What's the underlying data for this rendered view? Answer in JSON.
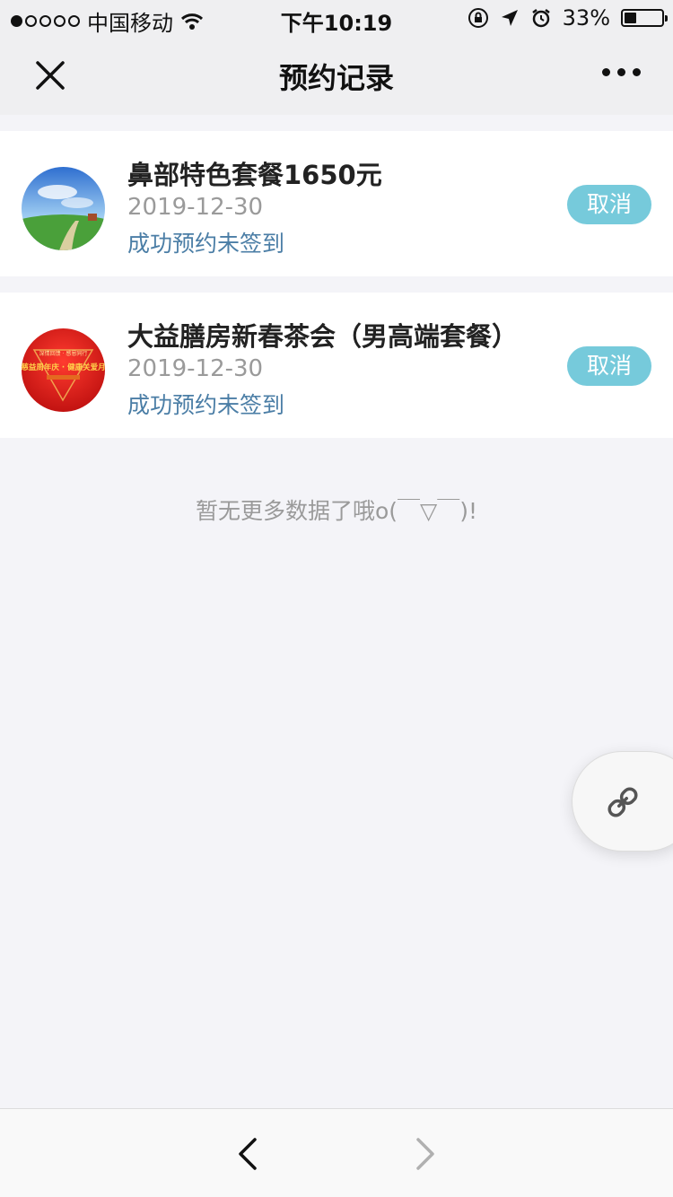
{
  "status_bar": {
    "carrier": "中国移动",
    "time": "下午10:19",
    "battery": "33%",
    "battery_level": 0.33
  },
  "nav": {
    "title": "预约记录"
  },
  "appointments": [
    {
      "title": "鼻部特色套餐1650元",
      "date": "2019-12-30",
      "status": "成功预约未签到",
      "cancel_label": "取消"
    },
    {
      "title": "大益膳房新春茶会（男高端套餐）",
      "date": "2019-12-30",
      "status": "成功预约未签到",
      "cancel_label": "取消",
      "thumb_text_top": "深情回馈 · 感恩同行",
      "thumb_text_main": "慈益周年庆 · 健康关爱月"
    }
  ],
  "empty_note": "暂无更多数据了哦o(￣▽￣)!",
  "colors": {
    "accent_button": "#76cadb",
    "status_text": "#4b7ea6",
    "background": "#f4f4f8"
  },
  "icons": [
    "wifi-icon",
    "lock-rotation-icon",
    "location-arrow-icon",
    "alarm-icon",
    "battery-icon",
    "close-icon",
    "more-icon",
    "link-icon",
    "back-arrow-icon",
    "forward-arrow-icon"
  ]
}
